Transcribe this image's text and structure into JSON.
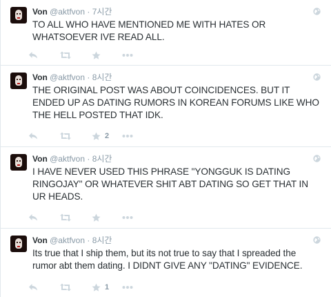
{
  "tweets": [
    {
      "name": "Von",
      "handle": "@aktfvon",
      "separator": "·",
      "time": "7시간",
      "text": "TO ALL WHO HAVE MENTIONED ME WITH HATES OR WHATSOEVER IVE READ ALL.",
      "favorite_count": "",
      "icons": [
        "reply-icon",
        "retweet-icon",
        "favorite-icon",
        "more-icon",
        "globe-icon"
      ]
    },
    {
      "name": "Von",
      "handle": "@aktfvon",
      "separator": "·",
      "time": "8시간",
      "text": "THE ORIGINAL POST WAS ABOUT COINCIDENCES. BUT IT ENDED UP AS DATING RUMORS IN KOREAN FORUMS LIKE WHO THE HELL POSTED THAT IDK.",
      "favorite_count": "2",
      "icons": [
        "reply-icon",
        "retweet-icon",
        "favorite-icon",
        "more-icon",
        "globe-icon"
      ]
    },
    {
      "name": "Von",
      "handle": "@aktfvon",
      "separator": "·",
      "time": "8시간",
      "text": "I HAVE NEVER USED THIS PHRASE \"YONGGUK IS DATING RINGOJAY\" OR WHATEVER SHIT ABT DATING SO GET THAT IN UR HEADS.",
      "favorite_count": "",
      "icons": [
        "reply-icon",
        "retweet-icon",
        "favorite-icon",
        "more-icon",
        "globe-icon"
      ]
    },
    {
      "name": "Von",
      "handle": "@aktfvon",
      "separator": "·",
      "time": "8시간",
      "text": "Its true that I ship them, but its not true to say that I spreaded the rumor abt them dating. I DIDNT GIVE ANY \"DATING\" EVIDENCE.",
      "favorite_count": "1",
      "icons": [
        "reply-icon",
        "retweet-icon",
        "favorite-icon",
        "more-icon",
        "globe-icon"
      ]
    }
  ],
  "colors": {
    "text": "#292f33",
    "muted": "#8899a6",
    "icon": "#ccd6dd",
    "border": "#e1e8ed"
  }
}
